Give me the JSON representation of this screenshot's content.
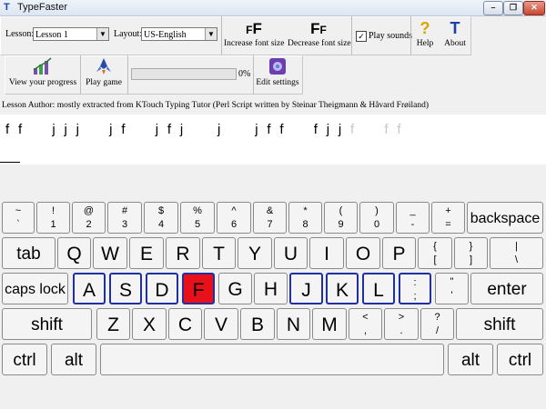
{
  "window": {
    "title": "TypeFaster",
    "app_icon": "T"
  },
  "toolbar": {
    "lesson_label": "Lesson:",
    "lesson_value": "Lesson 1",
    "layout_label": "Layout:",
    "layout_value": "US-English",
    "increase_font": "Increase font size",
    "decrease_font": "Decrease font size",
    "play_sounds": "Play sounds",
    "help": "Help",
    "about": "About",
    "view_progress": "View your progress",
    "play_game": "Play game",
    "progress_percent": "0%",
    "progress_value": 0,
    "edit_settings": "Edit settings"
  },
  "lesson_author": "Lesson Author: mostly extracted from KTouch Typing Tutor (Perl Script written by Steinar Theigmann & Håvard Frøiland)",
  "lesson_text": {
    "typed": "f  f       j  j  j       j  f       j  f  j        j        j  f  f       f  j  j",
    "pending": "  f       f  f"
  },
  "keyboard": {
    "row1": [
      {
        "top": "~",
        "bot": "`"
      },
      {
        "top": "!",
        "bot": "1"
      },
      {
        "top": "@",
        "bot": "2"
      },
      {
        "top": "#",
        "bot": "3"
      },
      {
        "top": "$",
        "bot": "4"
      },
      {
        "top": "%",
        "bot": "5"
      },
      {
        "top": "^",
        "bot": "6"
      },
      {
        "top": "&",
        "bot": "7"
      },
      {
        "top": "*",
        "bot": "8"
      },
      {
        "top": "(",
        "bot": "9"
      },
      {
        "top": ")",
        "bot": "0"
      },
      {
        "top": "_",
        "bot": "-"
      },
      {
        "top": "+",
        "bot": "="
      }
    ],
    "backspace": "backspace",
    "tab": "tab",
    "row2": [
      "Q",
      "W",
      "E",
      "R",
      "T",
      "Y",
      "U",
      "I",
      "O",
      "P"
    ],
    "row2_sym": [
      {
        "top": "{",
        "bot": "["
      },
      {
        "top": "}",
        "bot": "]"
      },
      {
        "top": "|",
        "bot": "\\"
      }
    ],
    "caps_lock": "caps lock",
    "row3": [
      "A",
      "S",
      "D",
      "F",
      "G",
      "H",
      "J",
      "K",
      "L"
    ],
    "row3_sym": [
      {
        "top": ":",
        "bot": ";"
      },
      {
        "top": "\"",
        "bot": "'"
      }
    ],
    "enter": "enter",
    "shift_left": "shift",
    "row4": [
      "Z",
      "X",
      "C",
      "V",
      "B",
      "N",
      "M"
    ],
    "row4_sym": [
      {
        "top": "<",
        "bot": ","
      },
      {
        "top": ">",
        "bot": "."
      },
      {
        "top": "?",
        "bot": "/"
      }
    ],
    "shift_right": "shift",
    "ctrl_left": "ctrl",
    "alt_left": "alt",
    "alt_right": "alt",
    "ctrl_right": "ctrl",
    "active_key": "F",
    "home_keys": [
      "A",
      "S",
      "D",
      "F",
      "J",
      "K",
      "L",
      ";"
    ],
    "colors": {
      "active": "#e8101a",
      "home_border": "#20309e"
    }
  }
}
